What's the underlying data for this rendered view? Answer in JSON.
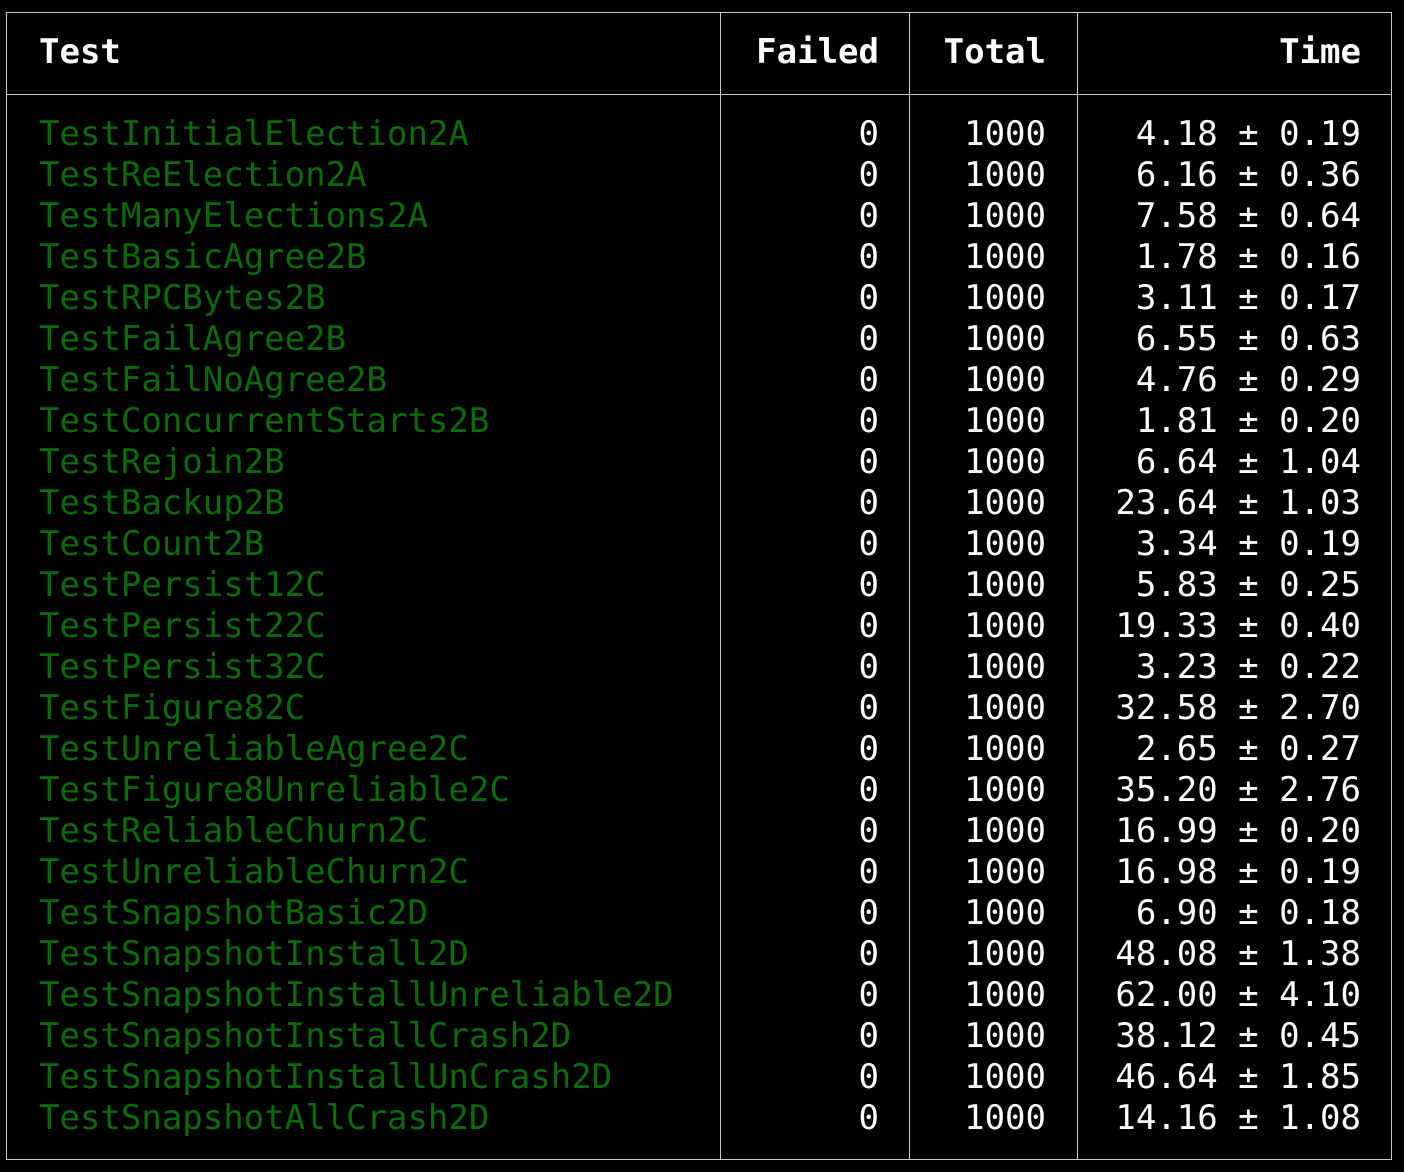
{
  "table": {
    "headers": {
      "test": "Test",
      "failed": "Failed",
      "total": "Total",
      "time": "Time"
    },
    "rows": [
      {
        "test": "TestInitialElection2A",
        "failed": "0",
        "total": "1000",
        "time": "4.18 ± 0.19"
      },
      {
        "test": "TestReElection2A",
        "failed": "0",
        "total": "1000",
        "time": "6.16 ± 0.36"
      },
      {
        "test": "TestManyElections2A",
        "failed": "0",
        "total": "1000",
        "time": "7.58 ± 0.64"
      },
      {
        "test": "TestBasicAgree2B",
        "failed": "0",
        "total": "1000",
        "time": "1.78 ± 0.16"
      },
      {
        "test": "TestRPCBytes2B",
        "failed": "0",
        "total": "1000",
        "time": "3.11 ± 0.17"
      },
      {
        "test": "TestFailAgree2B",
        "failed": "0",
        "total": "1000",
        "time": "6.55 ± 0.63"
      },
      {
        "test": "TestFailNoAgree2B",
        "failed": "0",
        "total": "1000",
        "time": "4.76 ± 0.29"
      },
      {
        "test": "TestConcurrentStarts2B",
        "failed": "0",
        "total": "1000",
        "time": "1.81 ± 0.20"
      },
      {
        "test": "TestRejoin2B",
        "failed": "0",
        "total": "1000",
        "time": "6.64 ± 1.04"
      },
      {
        "test": "TestBackup2B",
        "failed": "0",
        "total": "1000",
        "time": "23.64 ± 1.03"
      },
      {
        "test": "TestCount2B",
        "failed": "0",
        "total": "1000",
        "time": "3.34 ± 0.19"
      },
      {
        "test": "TestPersist12C",
        "failed": "0",
        "total": "1000",
        "time": "5.83 ± 0.25"
      },
      {
        "test": "TestPersist22C",
        "failed": "0",
        "total": "1000",
        "time": "19.33 ± 0.40"
      },
      {
        "test": "TestPersist32C",
        "failed": "0",
        "total": "1000",
        "time": "3.23 ± 0.22"
      },
      {
        "test": "TestFigure82C",
        "failed": "0",
        "total": "1000",
        "time": "32.58 ± 2.70"
      },
      {
        "test": "TestUnreliableAgree2C",
        "failed": "0",
        "total": "1000",
        "time": "2.65 ± 0.27"
      },
      {
        "test": "TestFigure8Unreliable2C",
        "failed": "0",
        "total": "1000",
        "time": "35.20 ± 2.76"
      },
      {
        "test": "TestReliableChurn2C",
        "failed": "0",
        "total": "1000",
        "time": "16.99 ± 0.20"
      },
      {
        "test": "TestUnreliableChurn2C",
        "failed": "0",
        "total": "1000",
        "time": "16.98 ± 0.19"
      },
      {
        "test": "TestSnapshotBasic2D",
        "failed": "0",
        "total": "1000",
        "time": "6.90 ± 0.18"
      },
      {
        "test": "TestSnapshotInstall2D",
        "failed": "0",
        "total": "1000",
        "time": "48.08 ± 1.38"
      },
      {
        "test": "TestSnapshotInstallUnreliable2D",
        "failed": "0",
        "total": "1000",
        "time": "62.00 ± 4.10"
      },
      {
        "test": "TestSnapshotInstallCrash2D",
        "failed": "0",
        "total": "1000",
        "time": "38.12 ± 0.45"
      },
      {
        "test": "TestSnapshotInstallUnCrash2D",
        "failed": "0",
        "total": "1000",
        "time": "46.64 ± 1.85"
      },
      {
        "test": "TestSnapshotAllCrash2D",
        "failed": "0",
        "total": "1000",
        "time": "14.16 ± 1.08"
      }
    ]
  },
  "colors": {
    "background": "#000000",
    "border": "#c9c9c9",
    "header_text": "#ffffff",
    "test_name": "#0c6a0c",
    "value_text": "#ffffff"
  }
}
